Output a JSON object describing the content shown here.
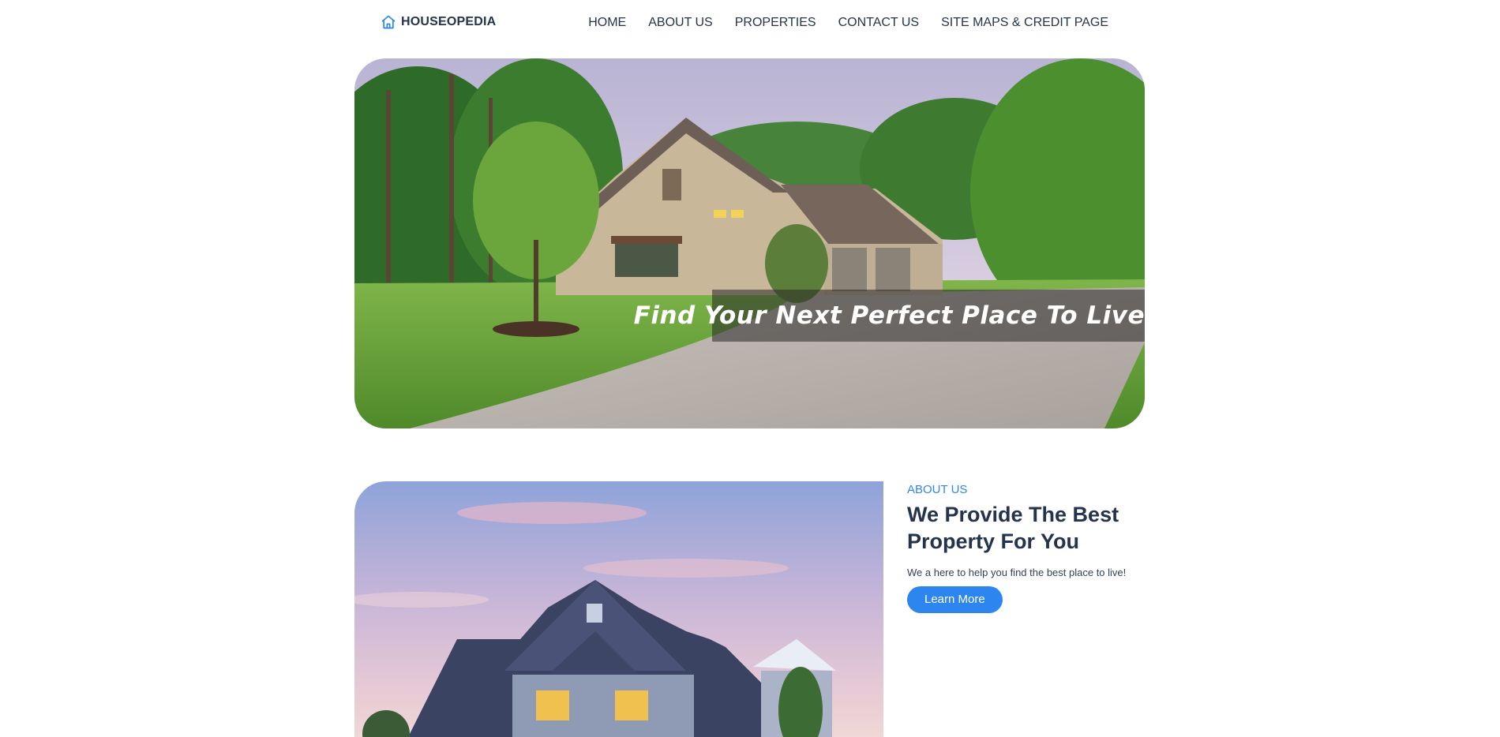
{
  "header": {
    "brand": "HOUSEOPEDIA",
    "brand_icon": "home-icon",
    "brand_color": "#2d86f0",
    "nav": [
      {
        "label": "HOME"
      },
      {
        "label": "ABOUT US"
      },
      {
        "label": "PROPERTIES"
      },
      {
        "label": "CONTACT US"
      },
      {
        "label": "SITE MAPS & CREDIT PAGE"
      }
    ]
  },
  "hero": {
    "caption": "Find Your Next Perfect Place To Live"
  },
  "about": {
    "eyebrow": "ABOUT US",
    "title": "We Provide The Best Property For You",
    "description": "We a here to help you find the best place to live!",
    "button_label": "Learn More",
    "accent_color": "#2d86f0"
  }
}
